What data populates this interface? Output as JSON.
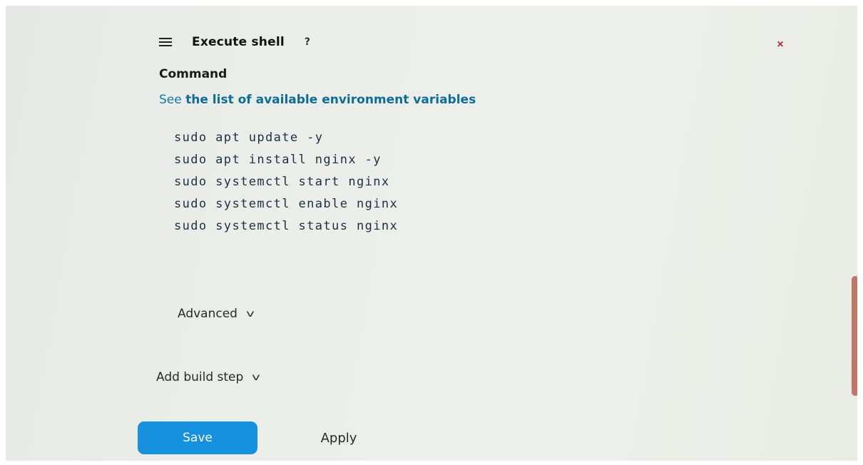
{
  "build_step": {
    "title": "Execute shell",
    "help_icon": "?",
    "close_icon": "×"
  },
  "command": {
    "label": "Command",
    "help_prefix": "See ",
    "help_link": "the list of available environment variables",
    "value": "sudo apt update -y\nsudo apt install nginx -y\nsudo systemctl start nginx\nsudo systemctl enable nginx\nsudo systemctl status nginx"
  },
  "advanced": {
    "label": "Advanced",
    "chevron": "v"
  },
  "add_build_step": {
    "label": "Add build step",
    "chevron": "v"
  },
  "actions": {
    "save_label": "Save",
    "apply_label": "Apply"
  },
  "colors": {
    "link": "#0c6d9b",
    "save_button": "#1591df",
    "close_icon": "#b42a3c",
    "scrollbar_thumb": "#b9644f"
  }
}
